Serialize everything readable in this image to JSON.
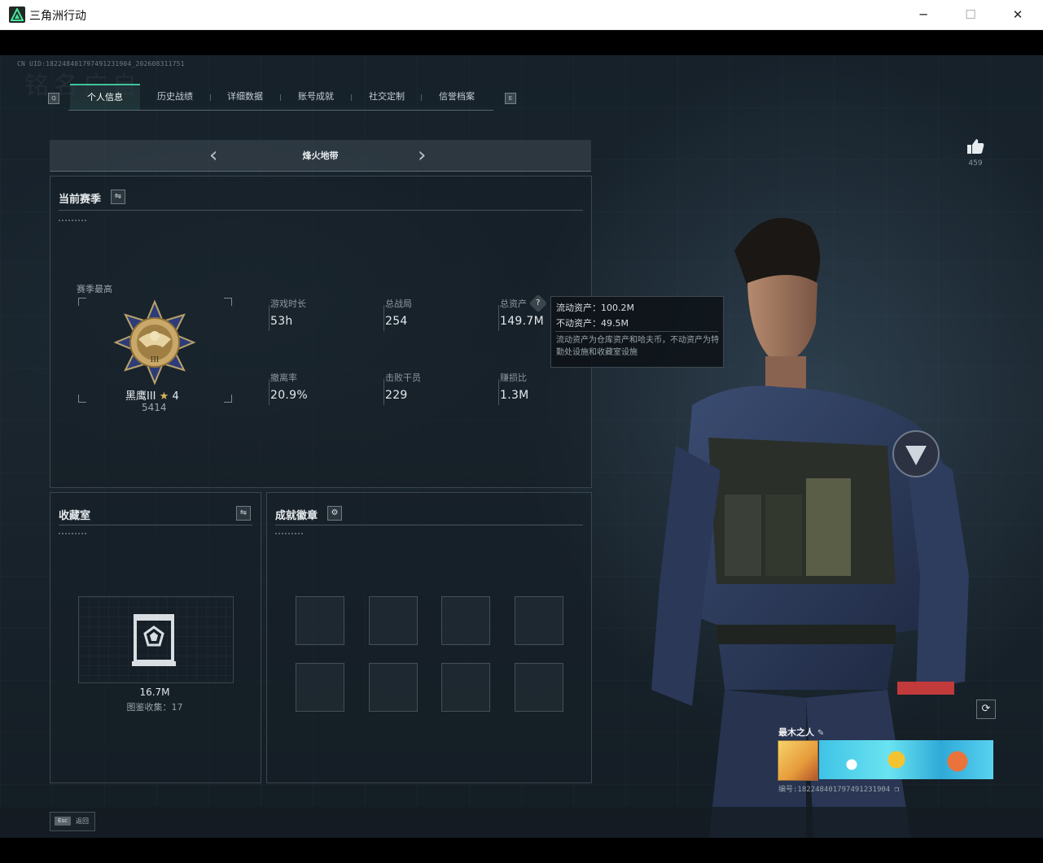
{
  "window": {
    "title": "三角洲行动",
    "minimize": "─",
    "maximize": "☐",
    "close": "✕"
  },
  "uid_text": "CN UID:18224840179749123190​4_202608311751",
  "ghost_text": "铭名广自",
  "tabs": {
    "left_key": "Q",
    "right_key": "E",
    "items": [
      {
        "label": "个人信息",
        "active": true
      },
      {
        "label": "历史战绩"
      },
      {
        "label": "详细数据"
      },
      {
        "label": "账号成就"
      },
      {
        "label": "社交定制"
      },
      {
        "label": "信誉档案"
      }
    ]
  },
  "season_nav": {
    "title": "烽火地带",
    "prev": "‹",
    "next": "›"
  },
  "current_season": {
    "title": "当前赛季",
    "peak_label": "赛季最高",
    "rank_name": "黑鹰III",
    "rank_stars": "4",
    "rank_points": "5414",
    "stats": [
      {
        "label": "游戏时长",
        "value": "53h"
      },
      {
        "label": "总战局",
        "value": "254"
      },
      {
        "label": "总资产",
        "value": "149.7M"
      },
      {
        "label": "撤离率",
        "value": "20.9%"
      },
      {
        "label": "击败干员",
        "value": "229"
      },
      {
        "label": "赚损比",
        "value": "1.3M"
      }
    ]
  },
  "tooltip": {
    "liquid": "流动资产：100.2M",
    "fixed": "不动资产：49.5M",
    "note": "流动资产为仓库资产和哈夫币，不动资产为特勤处设施和收藏室设施"
  },
  "collection": {
    "title": "收藏室",
    "value": "16.7M",
    "count_label": "图鉴收集：17"
  },
  "achievements": {
    "title": "成就徽章"
  },
  "likes": {
    "count": "459"
  },
  "player_card": {
    "name": "最木之人",
    "id_text": "编号:18224840179749123190​4"
  },
  "esc": {
    "key": "Esc",
    "label": "返回"
  },
  "colors": {
    "accent": "#3ec59a",
    "panel_border": "#3a464e"
  }
}
